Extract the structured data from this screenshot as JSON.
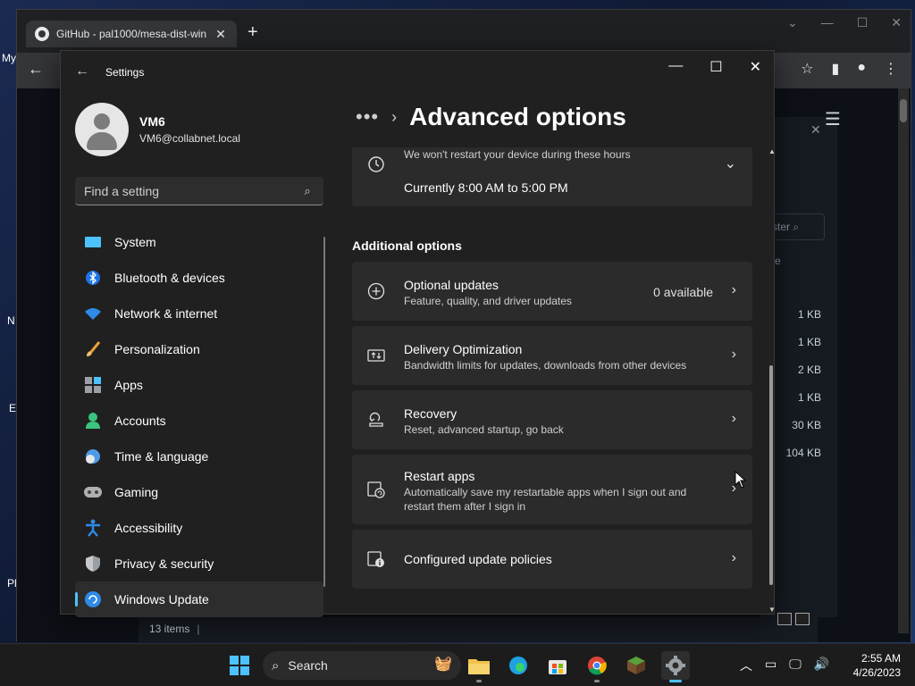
{
  "desktop": {
    "labels": [
      "My",
      "N",
      "E",
      "Pl"
    ]
  },
  "browser": {
    "tab_title": "GitHub - pal1000/mesa-dist-win",
    "new_tab": "+",
    "file_sizes": [
      "1 KB",
      "1 KB",
      "2 KB",
      "1 KB",
      "30 KB",
      "104 KB"
    ],
    "filter_placeholder": "ster",
    "count_text": "13 items",
    "misc_label": "e"
  },
  "settings": {
    "window_title": "Settings",
    "profile": {
      "name": "VM6",
      "email": "VM6@collabnet.local"
    },
    "search_placeholder": "Find a setting",
    "nav": [
      {
        "label": "System",
        "icon": "system-icon"
      },
      {
        "label": "Bluetooth & devices",
        "icon": "bluetooth-icon"
      },
      {
        "label": "Network & internet",
        "icon": "wifi-icon"
      },
      {
        "label": "Personalization",
        "icon": "brush-icon"
      },
      {
        "label": "Apps",
        "icon": "apps-icon"
      },
      {
        "label": "Accounts",
        "icon": "accounts-icon"
      },
      {
        "label": "Time & language",
        "icon": "clock-globe-icon"
      },
      {
        "label": "Gaming",
        "icon": "gamepad-icon"
      },
      {
        "label": "Accessibility",
        "icon": "accessibility-icon"
      },
      {
        "label": "Privacy & security",
        "icon": "shield-icon"
      },
      {
        "label": "Windows Update",
        "icon": "update-icon",
        "active": true
      }
    ],
    "breadcrumb": {
      "ellipsis": "•••",
      "title": "Advanced options"
    },
    "active_hours": {
      "text": "We won't restart your device during these hours",
      "value": "Currently 8:00 AM to 5:00 PM"
    },
    "section_title": "Additional options",
    "options": [
      {
        "title": "Optional updates",
        "sub": "Feature, quality, and driver updates",
        "value": "0 available",
        "icon": "plus-circle-icon"
      },
      {
        "title": "Delivery Optimization",
        "sub": "Bandwidth limits for updates, downloads from other devices",
        "icon": "delivery-optimization-icon"
      },
      {
        "title": "Recovery",
        "sub": "Reset, advanced startup, go back",
        "icon": "recovery-icon"
      },
      {
        "title": "Restart apps",
        "sub": "Automatically save my restartable apps when I sign out and restart them after I sign in",
        "icon": "restart-apps-icon"
      },
      {
        "title": "Configured update policies",
        "sub": "",
        "icon": "policy-icon"
      }
    ]
  },
  "taskbar": {
    "search_label": "Search",
    "time": "2:55 AM",
    "date": "4/26/2023"
  }
}
